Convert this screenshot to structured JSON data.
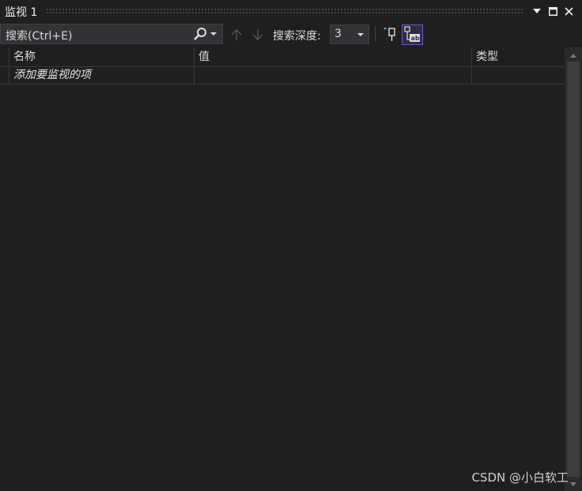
{
  "window": {
    "title": "监视 1",
    "buttons": [
      "chevron-down-icon",
      "maximize-icon",
      "close-icon"
    ]
  },
  "toolbar": {
    "search_value": "搜索(Ctrl+E)",
    "depth_label": "搜索深度:",
    "depth_value": "3"
  },
  "grid": {
    "columns": [
      "名称",
      "值",
      "类型"
    ],
    "rows": [
      {
        "name": "添加要监视的项",
        "value": "",
        "type": ""
      }
    ]
  },
  "watermark": "CSDN @小白软工"
}
